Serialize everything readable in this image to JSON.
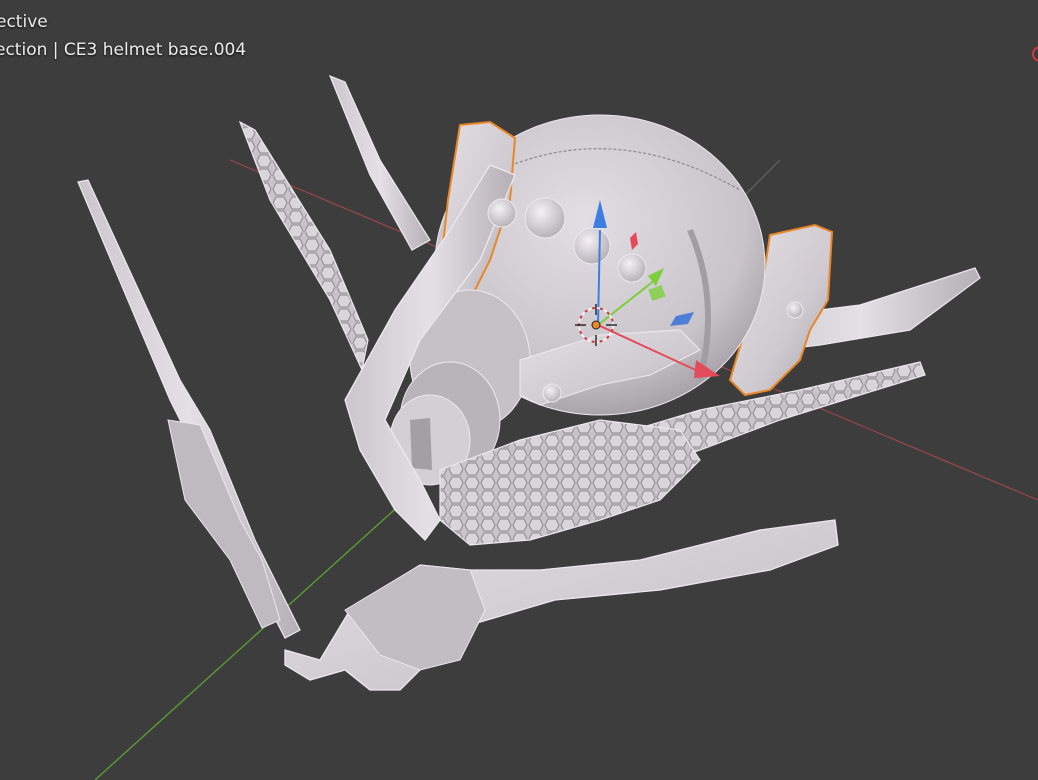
{
  "viewport": {
    "view_mode_label": "ective",
    "context_label": "ection | CE3 helmet base.004"
  },
  "colors": {
    "background": "#3d3d3d",
    "mesh_fill": "#d6d2d6",
    "mesh_shade": "#a9a4aa",
    "mesh_edge": "#ece9ee",
    "selection_outline": "#e8872a",
    "axis_x": "#b84545",
    "axis_y": "#5f9e35",
    "gizmo_z": "#3d7fe0",
    "gizmo_x": "#e44b5a",
    "gizmo_y": "#7ccf3a"
  },
  "icons": {
    "origin_cursor": "3d-cursor-icon",
    "transform_gizmo": "transform-gizmo-icon",
    "nav_gizmo": "navigation-gizmo-icon"
  }
}
